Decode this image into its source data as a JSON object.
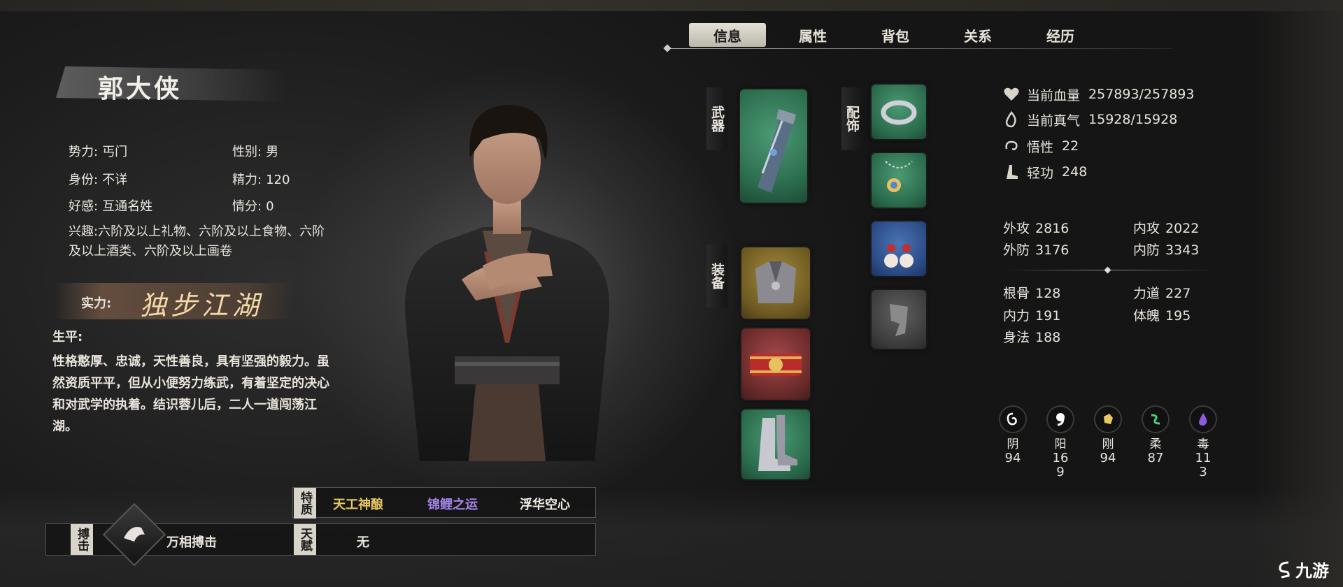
{
  "tabs": [
    {
      "label": "信息",
      "active": true
    },
    {
      "label": "属性",
      "active": false
    },
    {
      "label": "背包",
      "active": false
    },
    {
      "label": "关系",
      "active": false
    },
    {
      "label": "经历",
      "active": false
    }
  ],
  "character": {
    "name": "郭大侠",
    "faction_label": "势力:",
    "faction": "丐门",
    "gender_label": "性别:",
    "gender": "男",
    "identity_label": "身份:",
    "identity": "不详",
    "energy_label": "精力:",
    "energy": "120",
    "favor_label": "好感:",
    "favor": "互通名姓",
    "affection_label": "情分:",
    "affection": "0",
    "hobby_label": "兴趣:",
    "hobby": "六阶及以上礼物、六阶及以上食物、六阶及以上酒类、六阶及以上画卷",
    "power_label": "实力:",
    "power": "独步江湖",
    "bio_title": "生平:",
    "bio": "性格憨厚、忠诚，天性善良，具有坚强的毅力。虽然资质平平，但从小便努力练武，有着坚定的决心和对武学的执着。结识蓉儿后，二人一道闯荡江湖。"
  },
  "equipment": {
    "weapon_label": "武器",
    "gear_label": "装备",
    "accessory_label": "配饰"
  },
  "vitals": [
    {
      "icon": "heart-icon",
      "label": "当前血量",
      "value": "257893/257893"
    },
    {
      "icon": "flame-icon",
      "label": "当前真气",
      "value": "15928/15928"
    },
    {
      "icon": "swirl-icon",
      "label": "悟性",
      "value": "22"
    },
    {
      "icon": "boot-icon",
      "label": "轻功",
      "value": "248"
    }
  ],
  "combat": {
    "outer_atk_label": "外攻",
    "outer_atk": "2816",
    "inner_atk_label": "内攻",
    "inner_atk": "2022",
    "outer_def_label": "外防",
    "outer_def": "3176",
    "inner_def_label": "内防",
    "inner_def": "3343"
  },
  "attributes": {
    "bone_label": "根骨",
    "bone": "128",
    "strength_label": "力道",
    "strength": "227",
    "inner_label": "内力",
    "inner": "191",
    "physique_label": "体魄",
    "physique": "195",
    "agility_label": "身法",
    "agility": "188"
  },
  "elements": [
    {
      "name": "阴",
      "value": "94",
      "icon": "yin-icon",
      "color": "#ffffff"
    },
    {
      "name": "阳",
      "value": "169",
      "icon": "yang-icon",
      "color": "#ffffff"
    },
    {
      "name": "刚",
      "value": "94",
      "icon": "hard-icon",
      "color": "#e8c860"
    },
    {
      "name": "柔",
      "value": "87",
      "icon": "soft-icon",
      "color": "#4fd07a"
    },
    {
      "name": "毒",
      "value": "113",
      "icon": "poison-icon",
      "color": "#8a5ae0"
    }
  ],
  "traits": {
    "tag": "特质",
    "items": [
      {
        "label": "天工神酿",
        "color": "#e8c860"
      },
      {
        "label": "锦鲤之运",
        "color": "#a585ea"
      },
      {
        "label": "浮华空心",
        "color": "#f0ece4"
      }
    ]
  },
  "skill": {
    "tag": "搏击",
    "name": "万相搏击"
  },
  "talent": {
    "tag": "天赋",
    "value": "无"
  },
  "watermark": "九游"
}
